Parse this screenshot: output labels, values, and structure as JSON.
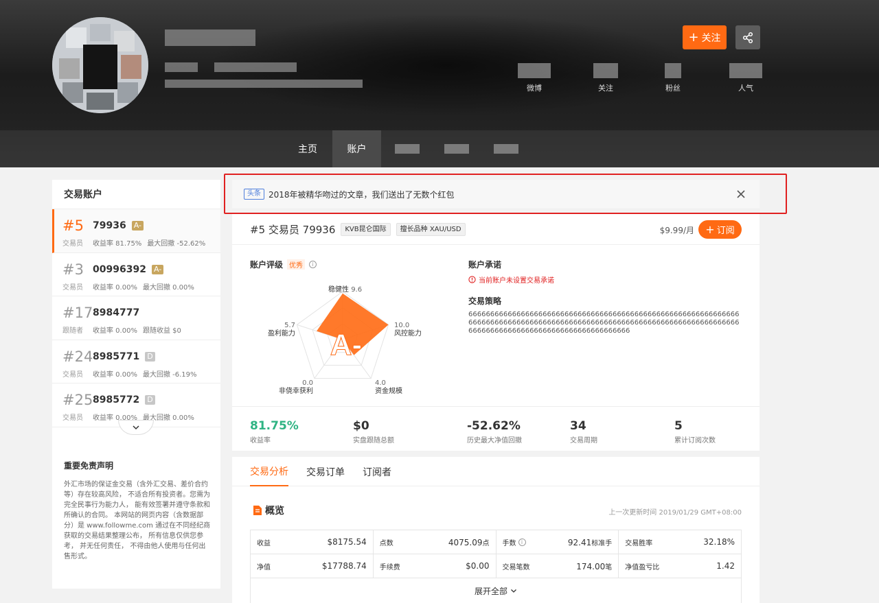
{
  "header": {
    "follow_label": "关注",
    "stats": [
      {
        "label": "微博"
      },
      {
        "label": "关注"
      },
      {
        "label": "粉丝"
      },
      {
        "label": "人气"
      }
    ],
    "nav": [
      {
        "label": "主页"
      },
      {
        "label": "账户"
      }
    ]
  },
  "sidebar": {
    "title": "交易账户",
    "accounts": [
      {
        "rank": "#5",
        "id": "79936",
        "grade": "A-",
        "role": "交易员",
        "m1": "收益率 81.75%",
        "m2": "最大回撤 -52.62%"
      },
      {
        "rank": "#3",
        "id": "00996392",
        "grade": "A-",
        "role": "交易员",
        "m1": "收益率 0.00%",
        "m2": "最大回撤 0.00%"
      },
      {
        "rank": "#17",
        "id": "8984777",
        "grade": "",
        "role": "跟随者",
        "m1": "收益率 0.00%",
        "m2": "跟随收益 $0"
      },
      {
        "rank": "#24",
        "id": "8985771",
        "grade": "D",
        "role": "交易员",
        "m1": "收益率 0.00%",
        "m2": "最大回撤 -6.19%"
      },
      {
        "rank": "#25",
        "id": "8985772",
        "grade": "D",
        "role": "交易员",
        "m1": "收益率 0.00%",
        "m2": "最大回撤 0.00%"
      }
    ],
    "disclaimer_title": "重要免责声明",
    "disclaimer_text": "外汇市场的保证金交易（含外汇交易、差价合约等）存在较高风险， 不适合所有投资者。您需为完全民事行为能力人， 能有效签署并遵守条款和所确认的合同。 本网站的网页内容（含数据部分）是 www.followme.com 通过在不同经纪商获取的交易结果整理公布， 所有信息仅供您参考， 并无任何责任， 不得由他人使用与任何出售形式。"
  },
  "notice": {
    "tag": "头条",
    "text": "2018年被精华吻过的文章，我们送出了无数个红包"
  },
  "account": {
    "title": "#5 交易员 79936",
    "broker": "KVB昆仑国际",
    "specialty": "擅长品种 XAU/USD",
    "price": "$9.99/月",
    "subscribe_label": "订阅",
    "rating_title": "账户评级",
    "rating_tag": "优秀",
    "grade": "A-",
    "promise_title": "账户承诺",
    "promise_warn": "当前账户未设置交易承诺",
    "strategy_title": "交易策略",
    "strategy_text": "66666666666666666666666666666666666666666666666666666666666666666666666666666666666666666666666666666666666666666666666666666666666666666666666666666666666666666"
  },
  "radar": {
    "axes": [
      {
        "label": "稳健性",
        "value": "9.6",
        "score": 9.6
      },
      {
        "label": "风控能力",
        "value": "10.0",
        "score": 10.0
      },
      {
        "label": "资金规模",
        "value": "4.0",
        "score": 4.0
      },
      {
        "label": "非侥幸获利",
        "value": "0.0",
        "score": 0.0
      },
      {
        "label": "盈利能力",
        "value": "5.7",
        "score": 5.7
      }
    ],
    "max": 10,
    "fill_color": "#ff6a13"
  },
  "metrics": [
    {
      "value": "81.75%",
      "label": "收益率"
    },
    {
      "value": "$0",
      "label": "实盘跟随总额"
    },
    {
      "value": "-52.62%",
      "label": "历史最大净值回撤"
    },
    {
      "value": "34",
      "label": "交易周期"
    },
    {
      "value": "5",
      "label": "累计订阅次数"
    }
  ],
  "analysis": {
    "tabs": [
      "交易分析",
      "交易订单",
      "订阅者"
    ],
    "overview_title": "概览",
    "update_time": "上一次更新时间 2019/01/29 GMT+08:00",
    "rows": [
      [
        {
          "k": "收益",
          "v": "$8175.54",
          "u": ""
        },
        {
          "k": "点数",
          "v": "4075.09",
          "u": "点"
        },
        {
          "k": "手数",
          "v": "92.41",
          "u": "标准手"
        },
        {
          "k": "交易胜率",
          "v": "32.18%",
          "u": ""
        }
      ],
      [
        {
          "k": "净值",
          "v": "$17788.74",
          "u": ""
        },
        {
          "k": "手续费",
          "v": "$0.00",
          "u": ""
        },
        {
          "k": "交易笔数",
          "v": "174.00",
          "u": "笔"
        },
        {
          "k": "净值盈亏比",
          "v": "1.42",
          "u": ""
        }
      ]
    ],
    "expand_label": "展开全部"
  },
  "colors": {
    "accent": "#ff6a13",
    "positive": "#2fb383",
    "warn": "#e02020",
    "gold_grade": "#c8a65f"
  }
}
